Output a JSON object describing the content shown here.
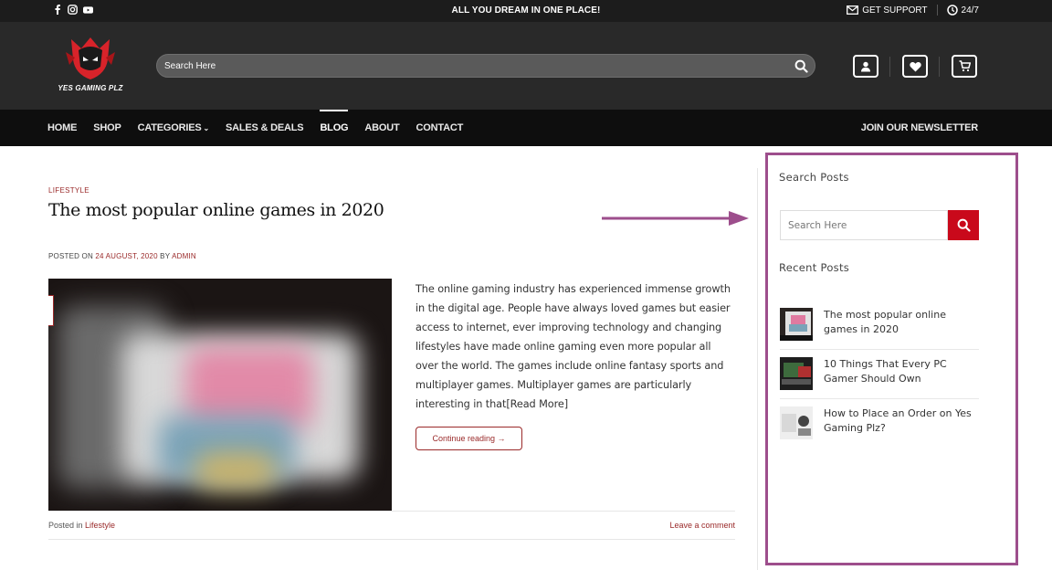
{
  "topbar": {
    "social_icons": [
      "facebook-icon",
      "instagram-icon",
      "youtube-icon"
    ],
    "tagline": "ALL YOU DREAM IN ONE PLACE!",
    "support_label": "GET SUPPORT",
    "hours_label": "24/7"
  },
  "header": {
    "logo_text": "YES GAMING PLZ",
    "search_placeholder": "Search Here",
    "icons": [
      "account-icon",
      "wishlist-heart-icon",
      "cart-icon"
    ]
  },
  "nav": {
    "items": [
      "HOME",
      "SHOP",
      "CATEGORIES",
      "SALES & DEALS",
      "BLOG",
      "ABOUT",
      "CONTACT"
    ],
    "active": "BLOG",
    "newsletter": "JOIN OUR NEWSLETTER"
  },
  "post": {
    "category": "LIFESTYLE",
    "title": "The most popular online games in 2020",
    "meta_prefix": "POSTED ON",
    "meta_date": "24 AUGUST, 2020",
    "meta_by": "BY",
    "meta_author": "ADMIN",
    "excerpt": "The online gaming industry has experienced immense growth in the digital age. People have always loved games but easier access to internet, ever improving technology and changing lifestyles have made online gaming even more popular all over the world. The games include online fantasy sports and multiplayer games. Multiplayer games are particularly interesting in that[Read More]",
    "read_more": "Continue reading →",
    "posted_in_label": "Posted in",
    "posted_in_category": "Lifestyle",
    "comment_link": "Leave a comment"
  },
  "sidebar": {
    "search_heading": "Search Posts",
    "search_placeholder": "Search Here",
    "recent_heading": "Recent Posts",
    "recent_posts": [
      {
        "title": "The most popular online games in 2020"
      },
      {
        "title": "10 Things That Every PC Gamer Should Own"
      },
      {
        "title": "How to Place an Order on Yes Gaming Plz?"
      }
    ]
  },
  "colors": {
    "accent_red": "#c9091b",
    "link_red": "#9a2a2a",
    "highlight_purple": "#9d4e8c",
    "header_bg": "#292929",
    "nav_bg": "#0e0e0e"
  }
}
